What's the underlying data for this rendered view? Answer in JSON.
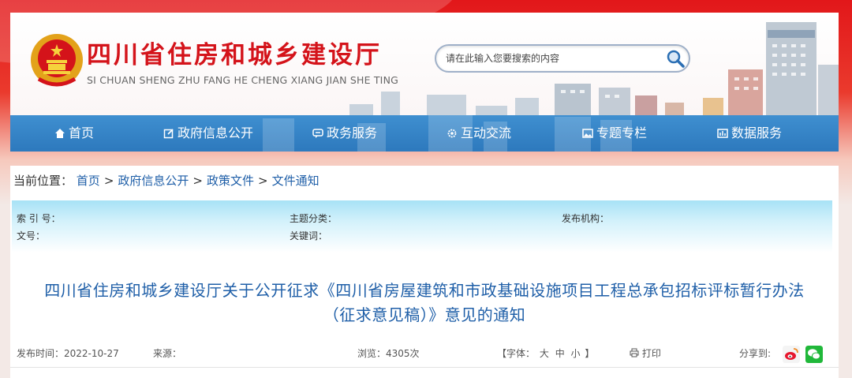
{
  "header": {
    "site_title": "四川省住房和城乡建设厅",
    "site_subtitle": "SI CHUAN SHENG ZHU FANG HE CHENG XIANG JIAN SHE TING",
    "search_placeholder": "请在此输入您要搜索的内容",
    "brand_color": "#d4131a"
  },
  "nav": {
    "items": [
      {
        "label": "首页",
        "icon": "home-icon"
      },
      {
        "label": "政府信息公开",
        "icon": "edit-icon"
      },
      {
        "label": "政务服务",
        "icon": "chat-icon"
      },
      {
        "label": "互动交流",
        "icon": "gear-icon"
      },
      {
        "label": "专题专栏",
        "icon": "picture-icon"
      },
      {
        "label": "数据服务",
        "icon": "bars-icon"
      }
    ],
    "color": "#2d79bd"
  },
  "breadcrumb": {
    "prefix": "当前位置：",
    "items": [
      "首页",
      "政府信息公开",
      "政策文件",
      "文件通知"
    ],
    "separator": ">"
  },
  "meta": {
    "index_no": "索 引 号：",
    "doc_no": "文号：",
    "topic": "主题分类：",
    "keywords": "关键词：",
    "publisher": "发布机构："
  },
  "document": {
    "title_line1": "四川省住房和城乡建设厅关于公开征求《四川省房屋建筑和市政基础设施项目工程总承包招标评标暂行办法",
    "title_line2": "（征求意见稿）》意见的通知",
    "publish_time": "发布时间：2022-10-27",
    "source": "来源：",
    "views": "浏览：4305次",
    "font_prefix": "【字体：",
    "font_large": "大",
    "font_medium": "中",
    "font_small": "小",
    "font_suffix": "】",
    "print": "打印",
    "share": "分享到:",
    "share_icons": [
      "weibo-icon",
      "wechat-icon"
    ]
  }
}
